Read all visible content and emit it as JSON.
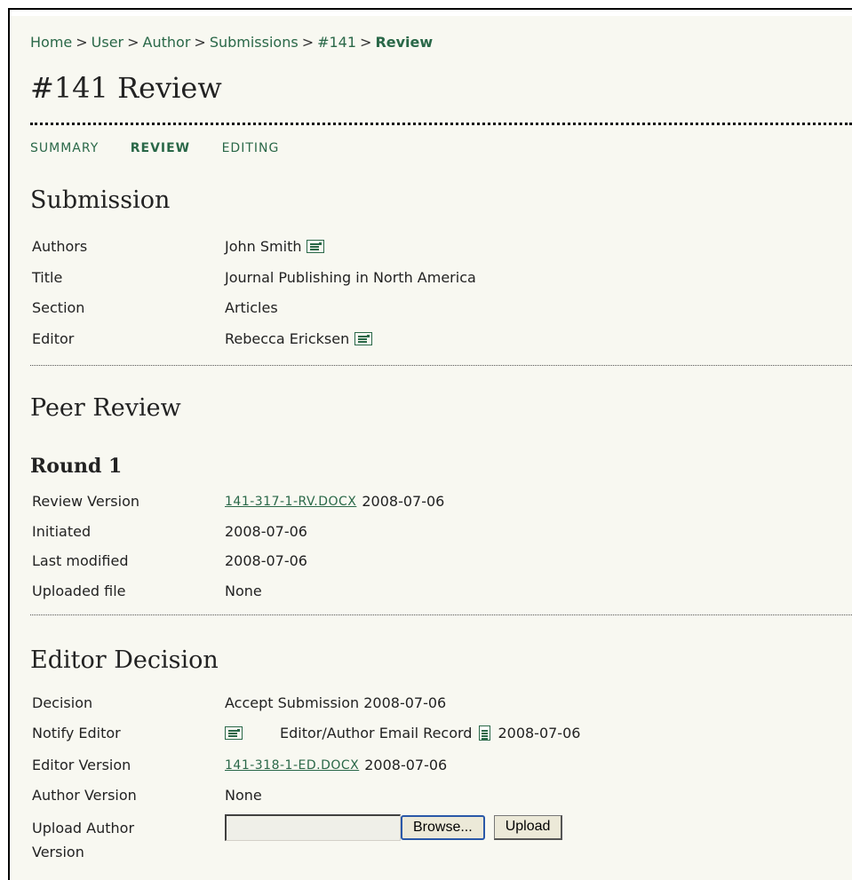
{
  "breadcrumb": {
    "items": [
      "Home",
      "User",
      "Author",
      "Submissions",
      "#141"
    ],
    "current": "Review",
    "separator": ">"
  },
  "page_title": "#141 Review",
  "tabs": [
    {
      "label": "SUMMARY",
      "active": false
    },
    {
      "label": "REVIEW",
      "active": true
    },
    {
      "label": "EDITING",
      "active": false
    }
  ],
  "submission": {
    "heading": "Submission",
    "authors_label": "Authors",
    "authors_value": "John Smith",
    "title_label": "Title",
    "title_value": "Journal Publishing in North America",
    "section_label": "Section",
    "section_value": "Articles",
    "editor_label": "Editor",
    "editor_value": "Rebecca Ericksen"
  },
  "peer_review": {
    "heading": "Peer Review",
    "round_heading": "Round 1",
    "review_version_label": "Review Version",
    "review_version_file": "141-317-1-RV.DOCX",
    "review_version_date": "2008-07-06",
    "initiated_label": "Initiated",
    "initiated_value": "2008-07-06",
    "last_modified_label": "Last modified",
    "last_modified_value": "2008-07-06",
    "uploaded_file_label": "Uploaded file",
    "uploaded_file_value": "None"
  },
  "editor_decision": {
    "heading": "Editor Decision",
    "decision_label": "Decision",
    "decision_value": "Accept Submission 2008-07-06",
    "notify_label": "Notify Editor",
    "notify_record_text": "Editor/Author Email Record",
    "notify_date": "2008-07-06",
    "editor_version_label": "Editor Version",
    "editor_version_file": "141-318-1-ED.DOCX",
    "editor_version_date": "2008-07-06",
    "author_version_label": "Author Version",
    "author_version_value": "None",
    "upload_label_line1": "Upload Author",
    "upload_label_line2": "Version",
    "browse_label": "Browse...",
    "upload_button_label": "Upload"
  },
  "colors": {
    "link": "#2a6848",
    "background": "#f8f8f1"
  },
  "icons": [
    "email-icon",
    "document-icon"
  ]
}
